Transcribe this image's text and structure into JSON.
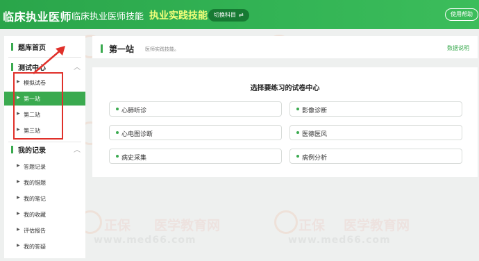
{
  "header": {
    "brand": "临床执业医师",
    "subject": "临床执业医师技能",
    "subject_active": "执业实践技能",
    "switch_label": "切换科目",
    "switch_icon": "⇄",
    "help_label": "使用帮助"
  },
  "sidebar": {
    "home": {
      "label": "题库首页"
    },
    "test_center": {
      "label": "测试中心",
      "chevron": "︿",
      "items": [
        {
          "label": "模拟试卷"
        },
        {
          "label": "第一站"
        },
        {
          "label": "第二站"
        },
        {
          "label": "第三站"
        }
      ]
    },
    "records": {
      "label": "我的记录",
      "chevron": "︿",
      "items": [
        {
          "label": "答题记录"
        },
        {
          "label": "我的错题"
        },
        {
          "label": "我的笔记"
        },
        {
          "label": "我的收藏"
        },
        {
          "label": "评估报告"
        },
        {
          "label": "我的答疑"
        }
      ]
    }
  },
  "topbar": {
    "title": "第一站",
    "description": "医师实践技能。",
    "link": "数据说明"
  },
  "panel": {
    "heading": "选择要练习的试卷中心",
    "options": [
      {
        "label": "心肺听诊"
      },
      {
        "label": "影像诊断"
      },
      {
        "label": "心电图诊断"
      },
      {
        "label": "医德医风"
      },
      {
        "label": "病史采集"
      },
      {
        "label": "病例分析"
      }
    ]
  },
  "watermark": {
    "brand": "正保",
    "text": "医学教育网",
    "url": "www.med66.com"
  },
  "colors": {
    "header_green": "#33b455",
    "accent_green": "#3aaa4f",
    "highlight_yellow": "#f2ff7a",
    "annotation_red": "#e0302a"
  }
}
